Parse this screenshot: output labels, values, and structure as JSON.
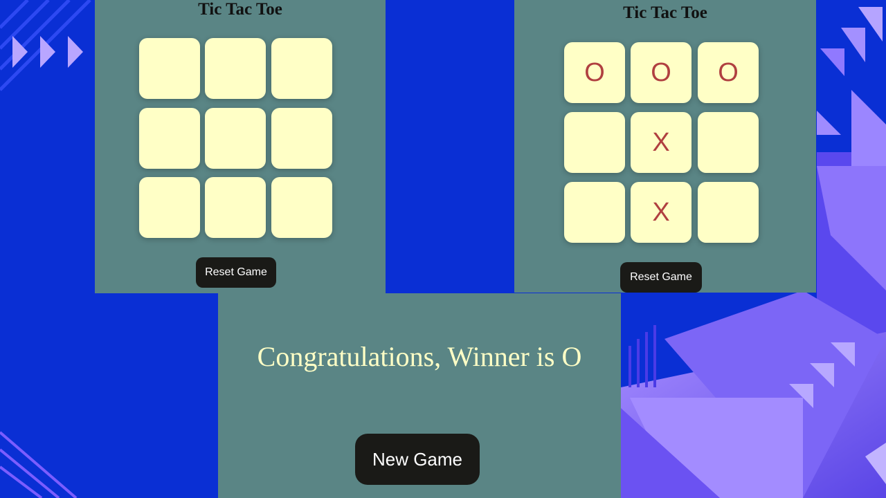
{
  "colors": {
    "page_bg": "#0a2fd4",
    "panel_bg": "#5a8585",
    "cell_bg": "#ffffc6",
    "mark": "#b04040",
    "button_bg": "#1a1a17",
    "message": "#ffffc6",
    "decor_purple": "#8c6cf2"
  },
  "left_game": {
    "title": "Tic Tac Toe",
    "cells": [
      "",
      "",
      "",
      "",
      "",
      "",
      "",
      "",
      ""
    ],
    "reset_label": "Reset Game"
  },
  "right_game": {
    "title": "Tic Tac Toe",
    "cells": [
      "O",
      "O",
      "O",
      "",
      "X",
      "",
      "",
      "X",
      ""
    ],
    "reset_label": "Reset Game"
  },
  "winner": {
    "message": "Congratulations, Winner is O",
    "new_game_label": "New Game"
  }
}
